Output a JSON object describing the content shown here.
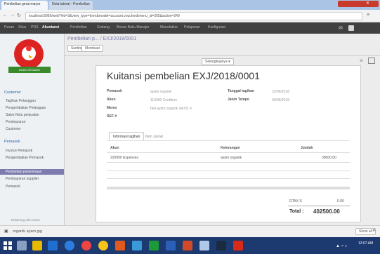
{
  "browser": {
    "tabs": [
      {
        "label": "Pembelian gerai mayor"
      },
      {
        "label": "Nota lateral - Pembelian"
      }
    ],
    "url": "localhost:8069/web?#id=3&view_type=form&model=account.voucher&menu_id=265&action=349"
  },
  "menubar": {
    "items": [
      "Pesan",
      "Situs",
      "POS",
      "Akuntansi",
      "Pembelian",
      "Gudang",
      "Bonus Buku Manajer",
      "Manufaktur",
      "Pelaporan",
      "Konfigurasi"
    ]
  },
  "sidebar": {
    "logo_text": "AYAM ORGANIK",
    "sections": [
      {
        "header": "Customer",
        "items": [
          "Tagihan Pelanggan",
          "Pengembalian Pelanggan",
          "Sales Nota penjualan",
          "Pembayaran",
          "Customer"
        ]
      },
      {
        "header": "Pemasok",
        "items": [
          "Invoice Pemasok",
          "Pengembalian Pemasok",
          "Pembelian penerimaan",
          "Pembayaran supplier",
          "Pemasok"
        ]
      }
    ],
    "selected": "Pembelian penerimaan",
    "powered": "Didukung oleh Odoo"
  },
  "header": {
    "breadcrumb": "Pembelian p... / EXJ/2018/0001",
    "btn_edit": "Sunting",
    "btn_create": "Membuat",
    "btn_more": "Selengkapnya"
  },
  "form": {
    "title": "Kuitansi pembelian  EXJ/2018/0001",
    "left_fields": [
      {
        "label": "Pemasok",
        "value": "ayam organik"
      },
      {
        "label": "Akun",
        "value": "110000 Creditors"
      },
      {
        "label": "Memo",
        "value": "beli ayam organik dari B. F"
      },
      {
        "label": "REF #",
        "value": ""
      }
    ],
    "right_fields": [
      {
        "label": "Tanggal tagihan",
        "value": "22/06/2018"
      },
      {
        "label": "Jatuh Tempo",
        "value": "30/06/2018"
      }
    ],
    "tabs": [
      "Informasi tagihan",
      "Item Jurnal"
    ],
    "table": {
      "headers": [
        "Akun",
        "Keterangan",
        "Jumlah"
      ],
      "rows": [
        [
          "220000 Expenses",
          "ayam organik",
          "30000.00"
        ]
      ]
    },
    "tax_label": "DTAX S",
    "tax_value": "0.00",
    "total_label": "Total :",
    "total_value": "402500.00"
  },
  "statusbar": {
    "download": "organik ayam.jpg",
    "show_all": "Show all"
  },
  "clock": "12:07 AM"
}
